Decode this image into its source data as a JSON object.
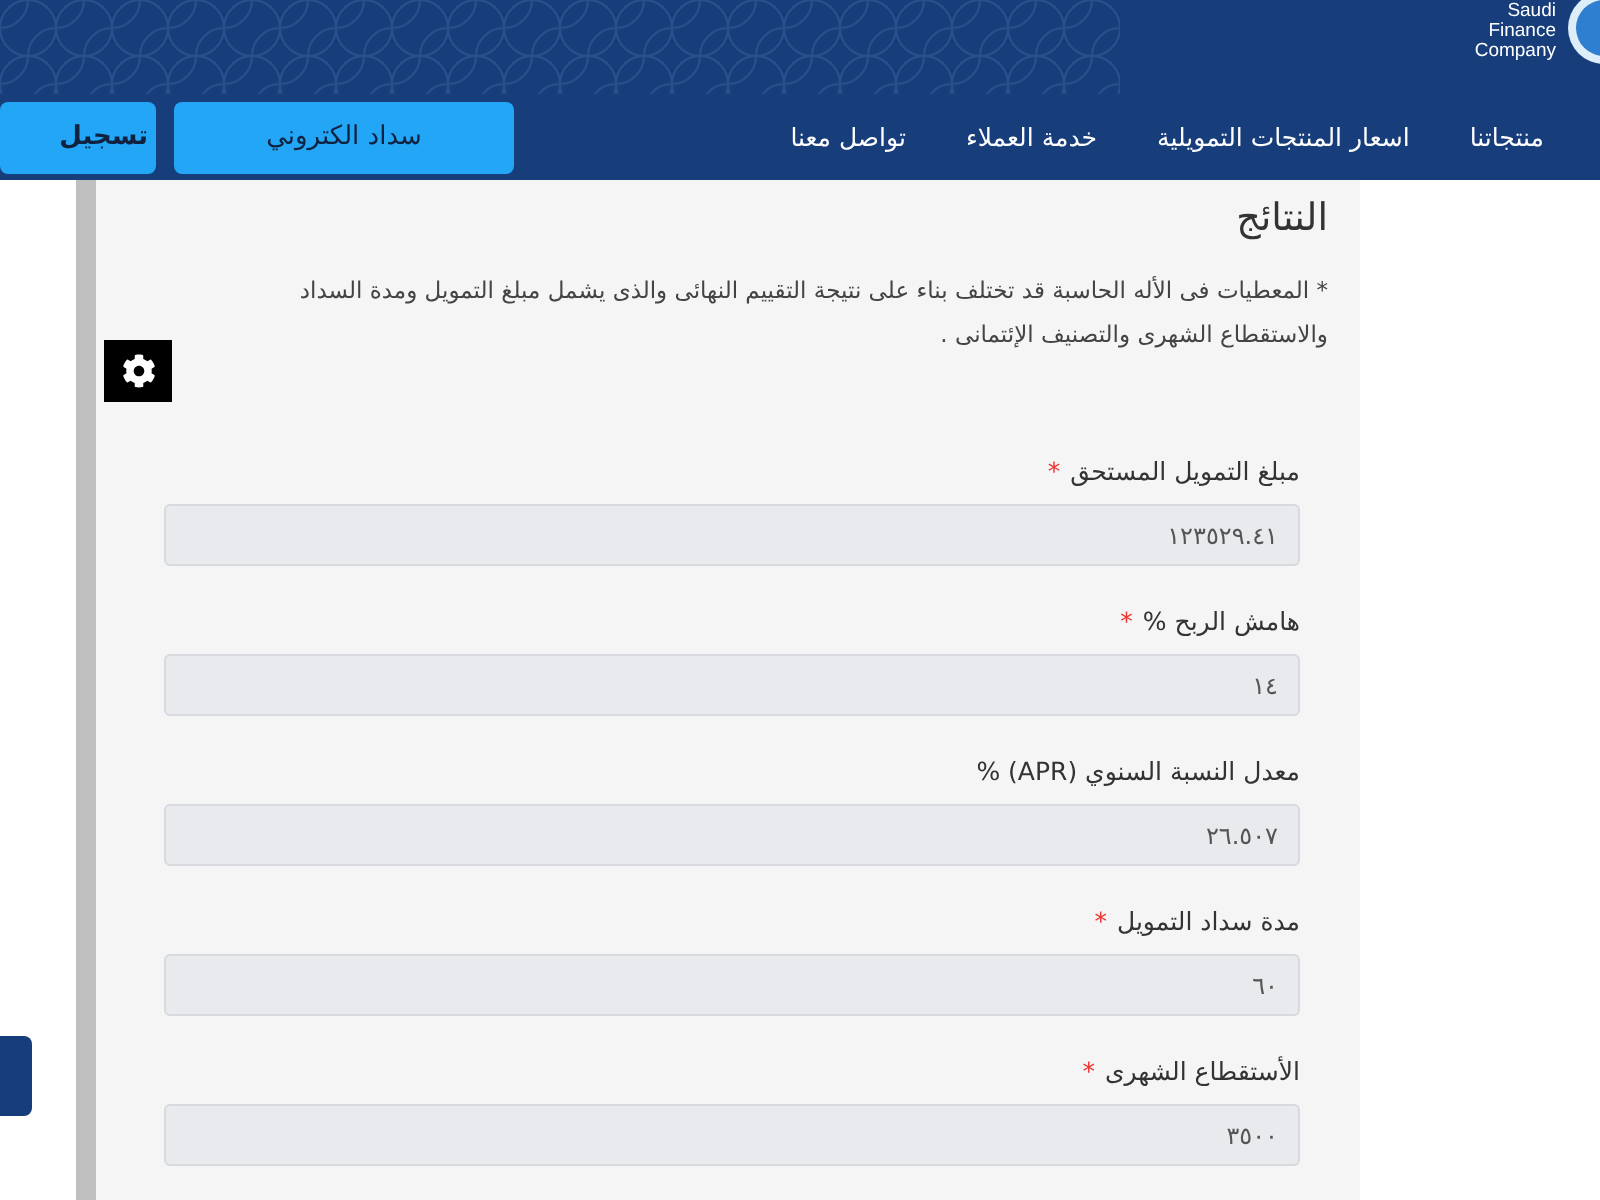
{
  "logo": {
    "lines": [
      "Saudi",
      "Finance",
      "Company"
    ]
  },
  "nav": {
    "items": [
      "منتجاتنا",
      "اسعار المنتجات التمويلية",
      "خدمة العملاء",
      "تواصل معنا"
    ],
    "buttons": [
      {
        "label": "سداد الكتروني",
        "kind": "primary"
      },
      {
        "label": "تسجيل",
        "kind": "secondary"
      }
    ]
  },
  "results": {
    "title": "النتائج",
    "note": "* المعطيات فى الأله الحاسبة قد تختلف بناء على نتيجة التقييم النهائى والذى يشمل مبلغ التمويل ومدة السداد والاستقطاع الشهرى والتصنيف الإئتمانى .",
    "required_mark": "*",
    "fields": [
      {
        "label": "مبلغ التمويل المستحق",
        "required": true,
        "value": "١٢٣٥٢٩.٤١"
      },
      {
        "label": "هامش الربح %",
        "required": true,
        "value": "١٤"
      },
      {
        "label": "معدل النسبة السنوي (APR) %",
        "required": false,
        "value": "٢٦.٥٠٧"
      },
      {
        "label": "مدة سداد التمويل",
        "required": true,
        "value": "٦٠"
      },
      {
        "label": "الأستقطاع الشهرى",
        "required": true,
        "value": "٣٥٠٠"
      }
    ]
  }
}
